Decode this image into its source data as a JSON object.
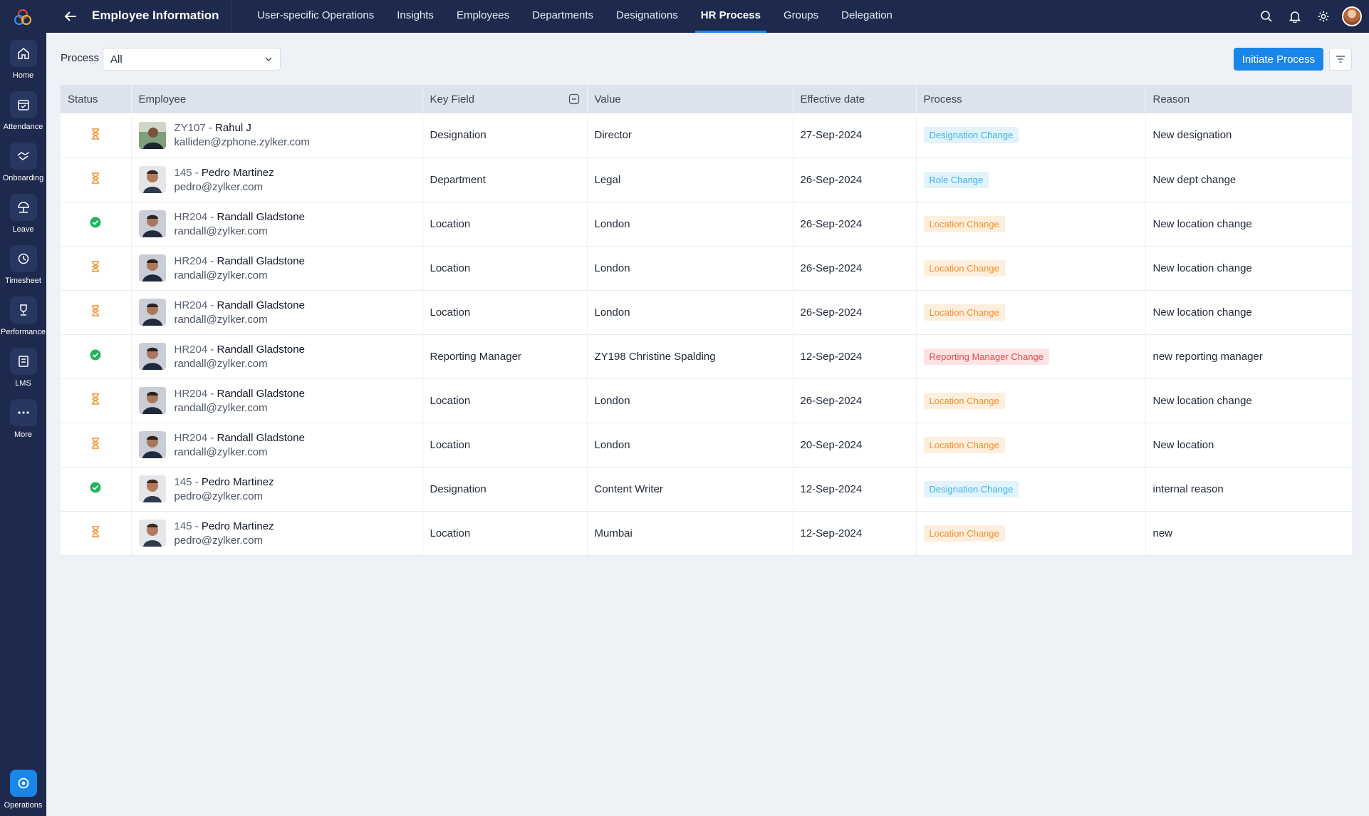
{
  "rail": {
    "items": [
      {
        "label": "Home",
        "icon": "home-icon"
      },
      {
        "label": "Attendance",
        "icon": "calendar-icon"
      },
      {
        "label": "Onboarding",
        "icon": "handshake-icon"
      },
      {
        "label": "Leave",
        "icon": "umbrella-icon"
      },
      {
        "label": "Timesheet",
        "icon": "clock-icon"
      },
      {
        "label": "Performance",
        "icon": "trophy-icon"
      },
      {
        "label": "LMS",
        "icon": "book-icon"
      },
      {
        "label": "More",
        "icon": "more-icon"
      }
    ],
    "bottom": {
      "label": "Operations",
      "icon": "operations-icon"
    }
  },
  "topbar": {
    "title": "Employee Information",
    "tabs": [
      "User-specific Operations",
      "Insights",
      "Employees",
      "Departments",
      "Designations",
      "HR Process",
      "Groups",
      "Delegation"
    ],
    "active_tab": "HR Process"
  },
  "toolbar": {
    "process_label": "Process",
    "process_value": "All",
    "initiate_label": "Initiate Process"
  },
  "table": {
    "headers": [
      "Status",
      "Employee",
      "Key Field",
      "Value",
      "Effective date",
      "Process",
      "Reason"
    ],
    "rows": [
      {
        "status": "pending",
        "id": "ZY107",
        "name": "Rahul J",
        "email": "kalliden@zphone.zylker.com",
        "key_field": "Designation",
        "value": "Director",
        "date": "27-Sep-2024",
        "process": "Designation Change",
        "process_color": "blue",
        "reason": "New designation",
        "photo": "rahul"
      },
      {
        "status": "pending",
        "id": "145",
        "name": "Pedro Martinez",
        "email": "pedro@zylker.com",
        "key_field": "Department",
        "value": "Legal",
        "date": "26-Sep-2024",
        "process": "Role Change",
        "process_color": "blue",
        "reason": "New dept change",
        "photo": "pedro"
      },
      {
        "status": "approved",
        "id": "HR204",
        "name": "Randall Gladstone",
        "email": "randall@zylker.com",
        "key_field": "Location",
        "value": "London",
        "date": "26-Sep-2024",
        "process": "Location Change",
        "process_color": "orange",
        "reason": "New location change",
        "photo": "randall"
      },
      {
        "status": "pending",
        "id": "HR204",
        "name": "Randall Gladstone",
        "email": "randall@zylker.com",
        "key_field": "Location",
        "value": "London",
        "date": "26-Sep-2024",
        "process": "Location Change",
        "process_color": "orange",
        "reason": "New location change",
        "photo": "randall"
      },
      {
        "status": "pending",
        "id": "HR204",
        "name": "Randall Gladstone",
        "email": "randall@zylker.com",
        "key_field": "Location",
        "value": "London",
        "date": "26-Sep-2024",
        "process": "Location Change",
        "process_color": "orange",
        "reason": "New location change",
        "photo": "randall"
      },
      {
        "status": "approved",
        "id": "HR204",
        "name": "Randall Gladstone",
        "email": "randall@zylker.com",
        "key_field": "Reporting Manager",
        "value": "ZY198 Christine Spalding",
        "date": "12-Sep-2024",
        "process": "Reporting Manager Change",
        "process_color": "red",
        "reason": "new reporting manager",
        "photo": "randall"
      },
      {
        "status": "pending",
        "id": "HR204",
        "name": "Randall Gladstone",
        "email": "randall@zylker.com",
        "key_field": "Location",
        "value": "London",
        "date": "26-Sep-2024",
        "process": "Location Change",
        "process_color": "orange",
        "reason": "New location change",
        "photo": "randall"
      },
      {
        "status": "pending",
        "id": "HR204",
        "name": "Randall Gladstone",
        "email": "randall@zylker.com",
        "key_field": "Location",
        "value": "London",
        "date": "20-Sep-2024",
        "process": "Location Change",
        "process_color": "orange",
        "reason": "New location",
        "photo": "randall"
      },
      {
        "status": "approved",
        "id": "145",
        "name": "Pedro Martinez",
        "email": "pedro@zylker.com",
        "key_field": "Designation",
        "value": "Content Writer",
        "date": "12-Sep-2024",
        "process": "Designation Change",
        "process_color": "blue",
        "reason": "internal reason",
        "photo": "pedro"
      },
      {
        "status": "pending",
        "id": "145",
        "name": "Pedro Martinez",
        "email": "pedro@zylker.com",
        "key_field": "Location",
        "value": "Mumbai",
        "date": "12-Sep-2024",
        "process": "Location Change",
        "process_color": "orange",
        "reason": "new",
        "photo": "pedro"
      }
    ]
  },
  "colors": {
    "brand": "#1a86e8",
    "nav_bg": "#1d2a4d",
    "pending": "#f0922d",
    "approved": "#21b35c"
  }
}
